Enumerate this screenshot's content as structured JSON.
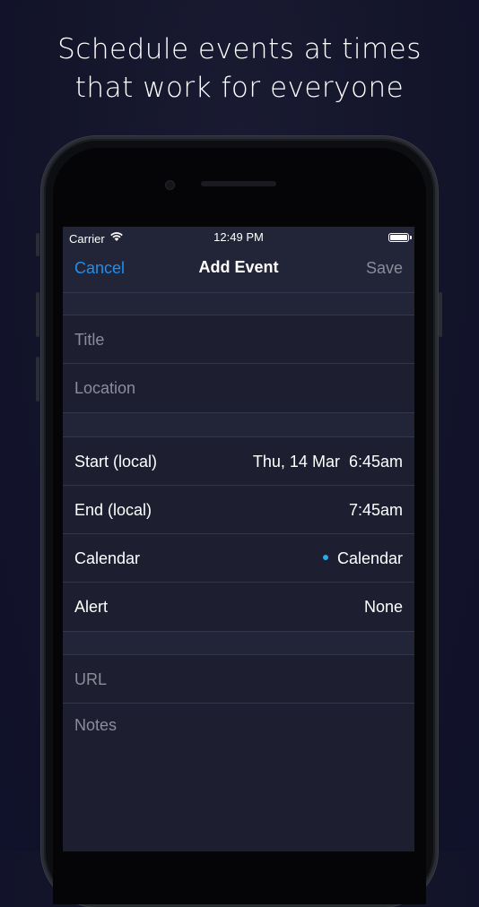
{
  "headline": {
    "line1": "Schedule events at times",
    "line2": "that work for everyone"
  },
  "status_bar": {
    "carrier": "Carrier",
    "time": "12:49 PM"
  },
  "nav": {
    "cancel_label": "Cancel",
    "title": "Add Event",
    "save_label": "Save"
  },
  "details": {
    "title_placeholder": "Title",
    "location_placeholder": "Location"
  },
  "schedule": {
    "start_label": "Start (local)",
    "start_value": "Thu, 14 Mar  6:45am",
    "end_label": "End (local)",
    "end_value": "7:45am",
    "calendar_label": "Calendar",
    "calendar_value": "Calendar",
    "calendar_color": "#2aa8f2",
    "alert_label": "Alert",
    "alert_value": "None"
  },
  "extra": {
    "url_placeholder": "URL",
    "notes_placeholder": "Notes"
  },
  "colors": {
    "accent": "#1f8ff2",
    "background": "#13142a",
    "screen": "#222437"
  }
}
